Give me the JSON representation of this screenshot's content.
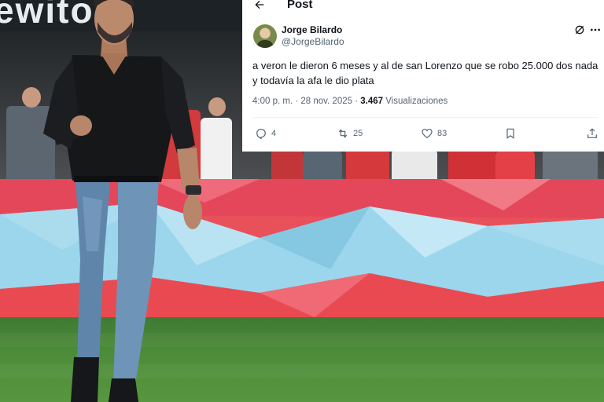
{
  "header": {
    "title": "Post",
    "back_icon": "back-arrow-icon"
  },
  "author": {
    "name": "Jorge Bilardo",
    "handle": "@JorgeBilardo",
    "avatar_icon": "avatar"
  },
  "post": {
    "text": "a veron le dieron 6 meses y al de san Lorenzo que se robo 25.000 dos nada y todavía la afa le dio plata",
    "time": "4:00 p. m. · 28 nov. 2025 · ",
    "views_count": "3.467",
    "views_label": " Visualizaciones"
  },
  "actions": {
    "replies": "4",
    "reposts": "25",
    "likes": "83"
  },
  "icons": {
    "grok": "grok-icon",
    "more": "more-icon",
    "reply": "reply-icon",
    "repost": "repost-icon",
    "like": "heart-icon",
    "bookmark": "bookmark-icon",
    "share": "share-icon"
  },
  "colors": {
    "text_primary": "#0f1419",
    "text_secondary": "#536471",
    "board_red": "#e8505a",
    "board_blue": "#8fd0ea",
    "pitch_green": "#4d8d3a"
  }
}
